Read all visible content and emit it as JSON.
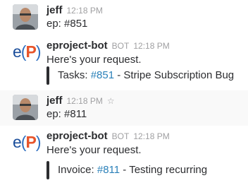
{
  "messages": [
    {
      "user": "jeff",
      "time": "12:18 PM",
      "text": "ep: #851"
    },
    {
      "user": "eproject-bot",
      "badge": "BOT",
      "time": "12:18 PM",
      "text": "Here's your request.",
      "attachment": {
        "prefix": "Tasks: ",
        "link": "#851",
        "suffix": " - Stripe Subscription Bug"
      }
    },
    {
      "user": "jeff",
      "time": "12:18 PM",
      "text": "ep: #811"
    },
    {
      "user": "eproject-bot",
      "badge": "BOT",
      "time": "12:18 PM",
      "text": "Here's your request.",
      "attachment": {
        "prefix": "Invoice: ",
        "link": "#811",
        "suffix": " - Testing recurring"
      }
    }
  ],
  "bot_avatar": {
    "e": "e",
    "open": "(",
    "p": "P",
    "close": ")"
  },
  "icons": {
    "star": "star-icon"
  },
  "colors": {
    "link": "#2a80b9",
    "bot_e": "#1b4e9b",
    "bot_p": "#e8542a",
    "hover_row": "#f9f9f9"
  }
}
